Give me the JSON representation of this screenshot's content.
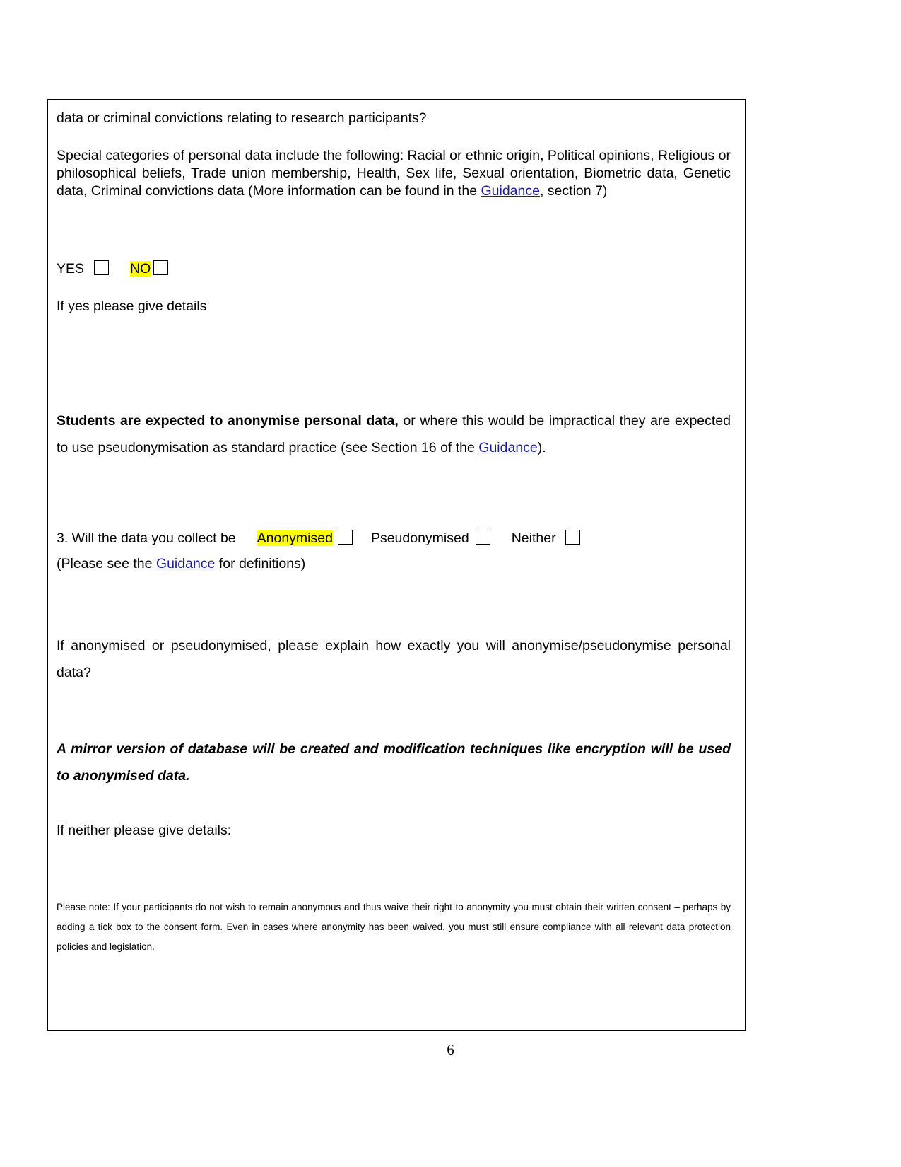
{
  "document": {
    "page_number": "6",
    "link_label": "Guidance",
    "highlight_color": "#ffff00",
    "link_color": "#1a1aa8"
  },
  "section": {
    "question2_tail": "data or criminal convictions relating to research participants?",
    "special_categories": {
      "lead": "Special categories of personal data include the following: Racial or ethnic origin, Political opinions, Religious or philosophical beliefs, Trade union membership, Health, Sex life, Sexual orientation, Biometric data, Genetic data, Criminal convictions data (More information can be found in the ",
      "link": "Guidance",
      "tail": ", section 7)"
    },
    "yesno": {
      "yes_label": "YES",
      "no_label": "NO",
      "yes_checked": false,
      "no_checked": false
    },
    "if_yes_details": "If yes please give details",
    "anonymise_note": {
      "bold_part": "Students are expected to anonymise personal data,",
      "regular_part": " or where this would be impractical they are expected to use pseudonymisation as standard practice (see Section 16 of the ",
      "link": "Guidance",
      "tail": ")."
    },
    "question3": {
      "prompt": "3. Will the data you collect be",
      "option_anonymised": "Anonymised",
      "option_pseudonymised": "Pseudonymised",
      "option_neither": "Neither",
      "anonymised_checked": false,
      "pseudonymised_checked": false,
      "neither_checked": false,
      "subnote_prefix": "(Please see the ",
      "subnote_link": "Guidance",
      "subnote_suffix": " for definitions)"
    },
    "explain_prompt": "If anonymised or pseudonymised, please explain how exactly you will anonymise/pseudonymise personal data?",
    "answer_text": "A mirror version of database will be created and modification techniques like encryption will be used to anonymised data.",
    "if_neither_prompt": "If neither please give details:",
    "please_note": "Please note: If your participants do not wish to remain anonymous and thus waive their right to anonymity you must obtain their written consent – perhaps by adding a tick box to the consent form. Even in cases where anonymity has been waived, you must still ensure compliance with all relevant data protection policies and legislation."
  }
}
